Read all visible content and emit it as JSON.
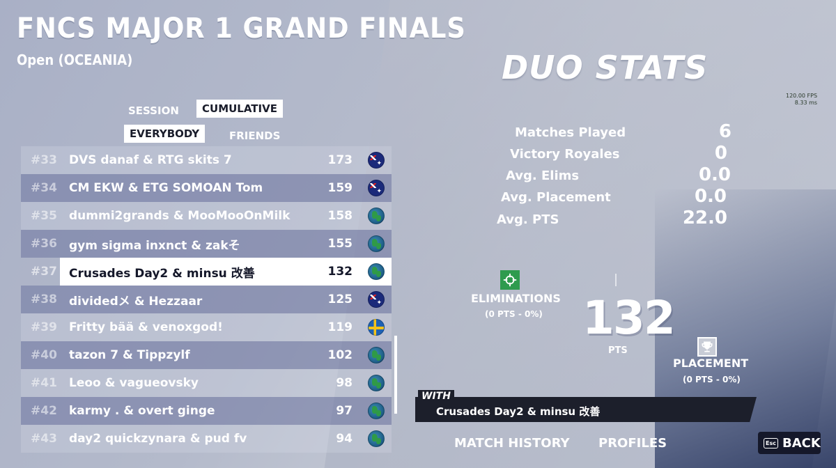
{
  "header": {
    "title": "FNCS MAJOR 1 GRAND FINALS",
    "subtitle": "Open (OCEANIA)"
  },
  "tabs": {
    "session": "SESSION",
    "cumulative": "CUMULATIVE",
    "everybody": "EVERYBODY",
    "friends": "FRIENDS"
  },
  "leaderboard": [
    {
      "rank": "#33",
      "name": "DVS danaf & RTG skits 7",
      "points": "173",
      "flag": "au"
    },
    {
      "rank": "#34",
      "name": "CM EKW & ETG SOMOAN Tom",
      "points": "159",
      "flag": "au"
    },
    {
      "rank": "#35",
      "name": "dummi2grands & MooMooOnMilk",
      "points": "158",
      "flag": "globe"
    },
    {
      "rank": "#36",
      "name": "gym sigma inxnct & zakそ",
      "points": "155",
      "flag": "globe"
    },
    {
      "rank": "#37",
      "name": "Crusades Day2 & minsu 改善",
      "points": "132",
      "flag": "globe"
    },
    {
      "rank": "#38",
      "name": "dividedメ & Hezzaar",
      "points": "125",
      "flag": "au"
    },
    {
      "rank": "#39",
      "name": "Fritty bää & venoxgod!",
      "points": "119",
      "flag": "se"
    },
    {
      "rank": "#40",
      "name": "tazon 7 & Tippzylf",
      "points": "102",
      "flag": "globe"
    },
    {
      "rank": "#41",
      "name": "Leoo & vagueovsky",
      "points": "98",
      "flag": "globe"
    },
    {
      "rank": "#42",
      "name": "karmy . & overt ginge",
      "points": "97",
      "flag": "globe"
    },
    {
      "rank": "#43",
      "name": "day2 quickzynara & pud fv",
      "points": "94",
      "flag": "globe"
    }
  ],
  "duo_stats": {
    "title": "DUO STATS",
    "fps": "120.00 FPS",
    "frametime": "8.33 ms",
    "stats": [
      {
        "label": "Matches Played",
        "value": "6"
      },
      {
        "label": "Victory Royales",
        "value": "0"
      },
      {
        "label": "Avg. Elims",
        "value": "0.0"
      },
      {
        "label": "Avg. Placement",
        "value": "0.0"
      },
      {
        "label": "Avg. PTS",
        "value": "22.0"
      }
    ],
    "eliminations_label": "ELIMINATIONS",
    "eliminations_sub": "(0 PTS - 0%)",
    "total_points": "132",
    "points_label": "PTS",
    "placement_label": "PLACEMENT",
    "placement_sub": "(0 PTS - 0%)",
    "with_label": "WITH",
    "with_name": "Crusades Day2 & minsu 改善"
  },
  "footer": {
    "match_history": "MATCH HISTORY",
    "profiles": "PROFILES",
    "esc_key": "Esc",
    "back": "BACK"
  }
}
